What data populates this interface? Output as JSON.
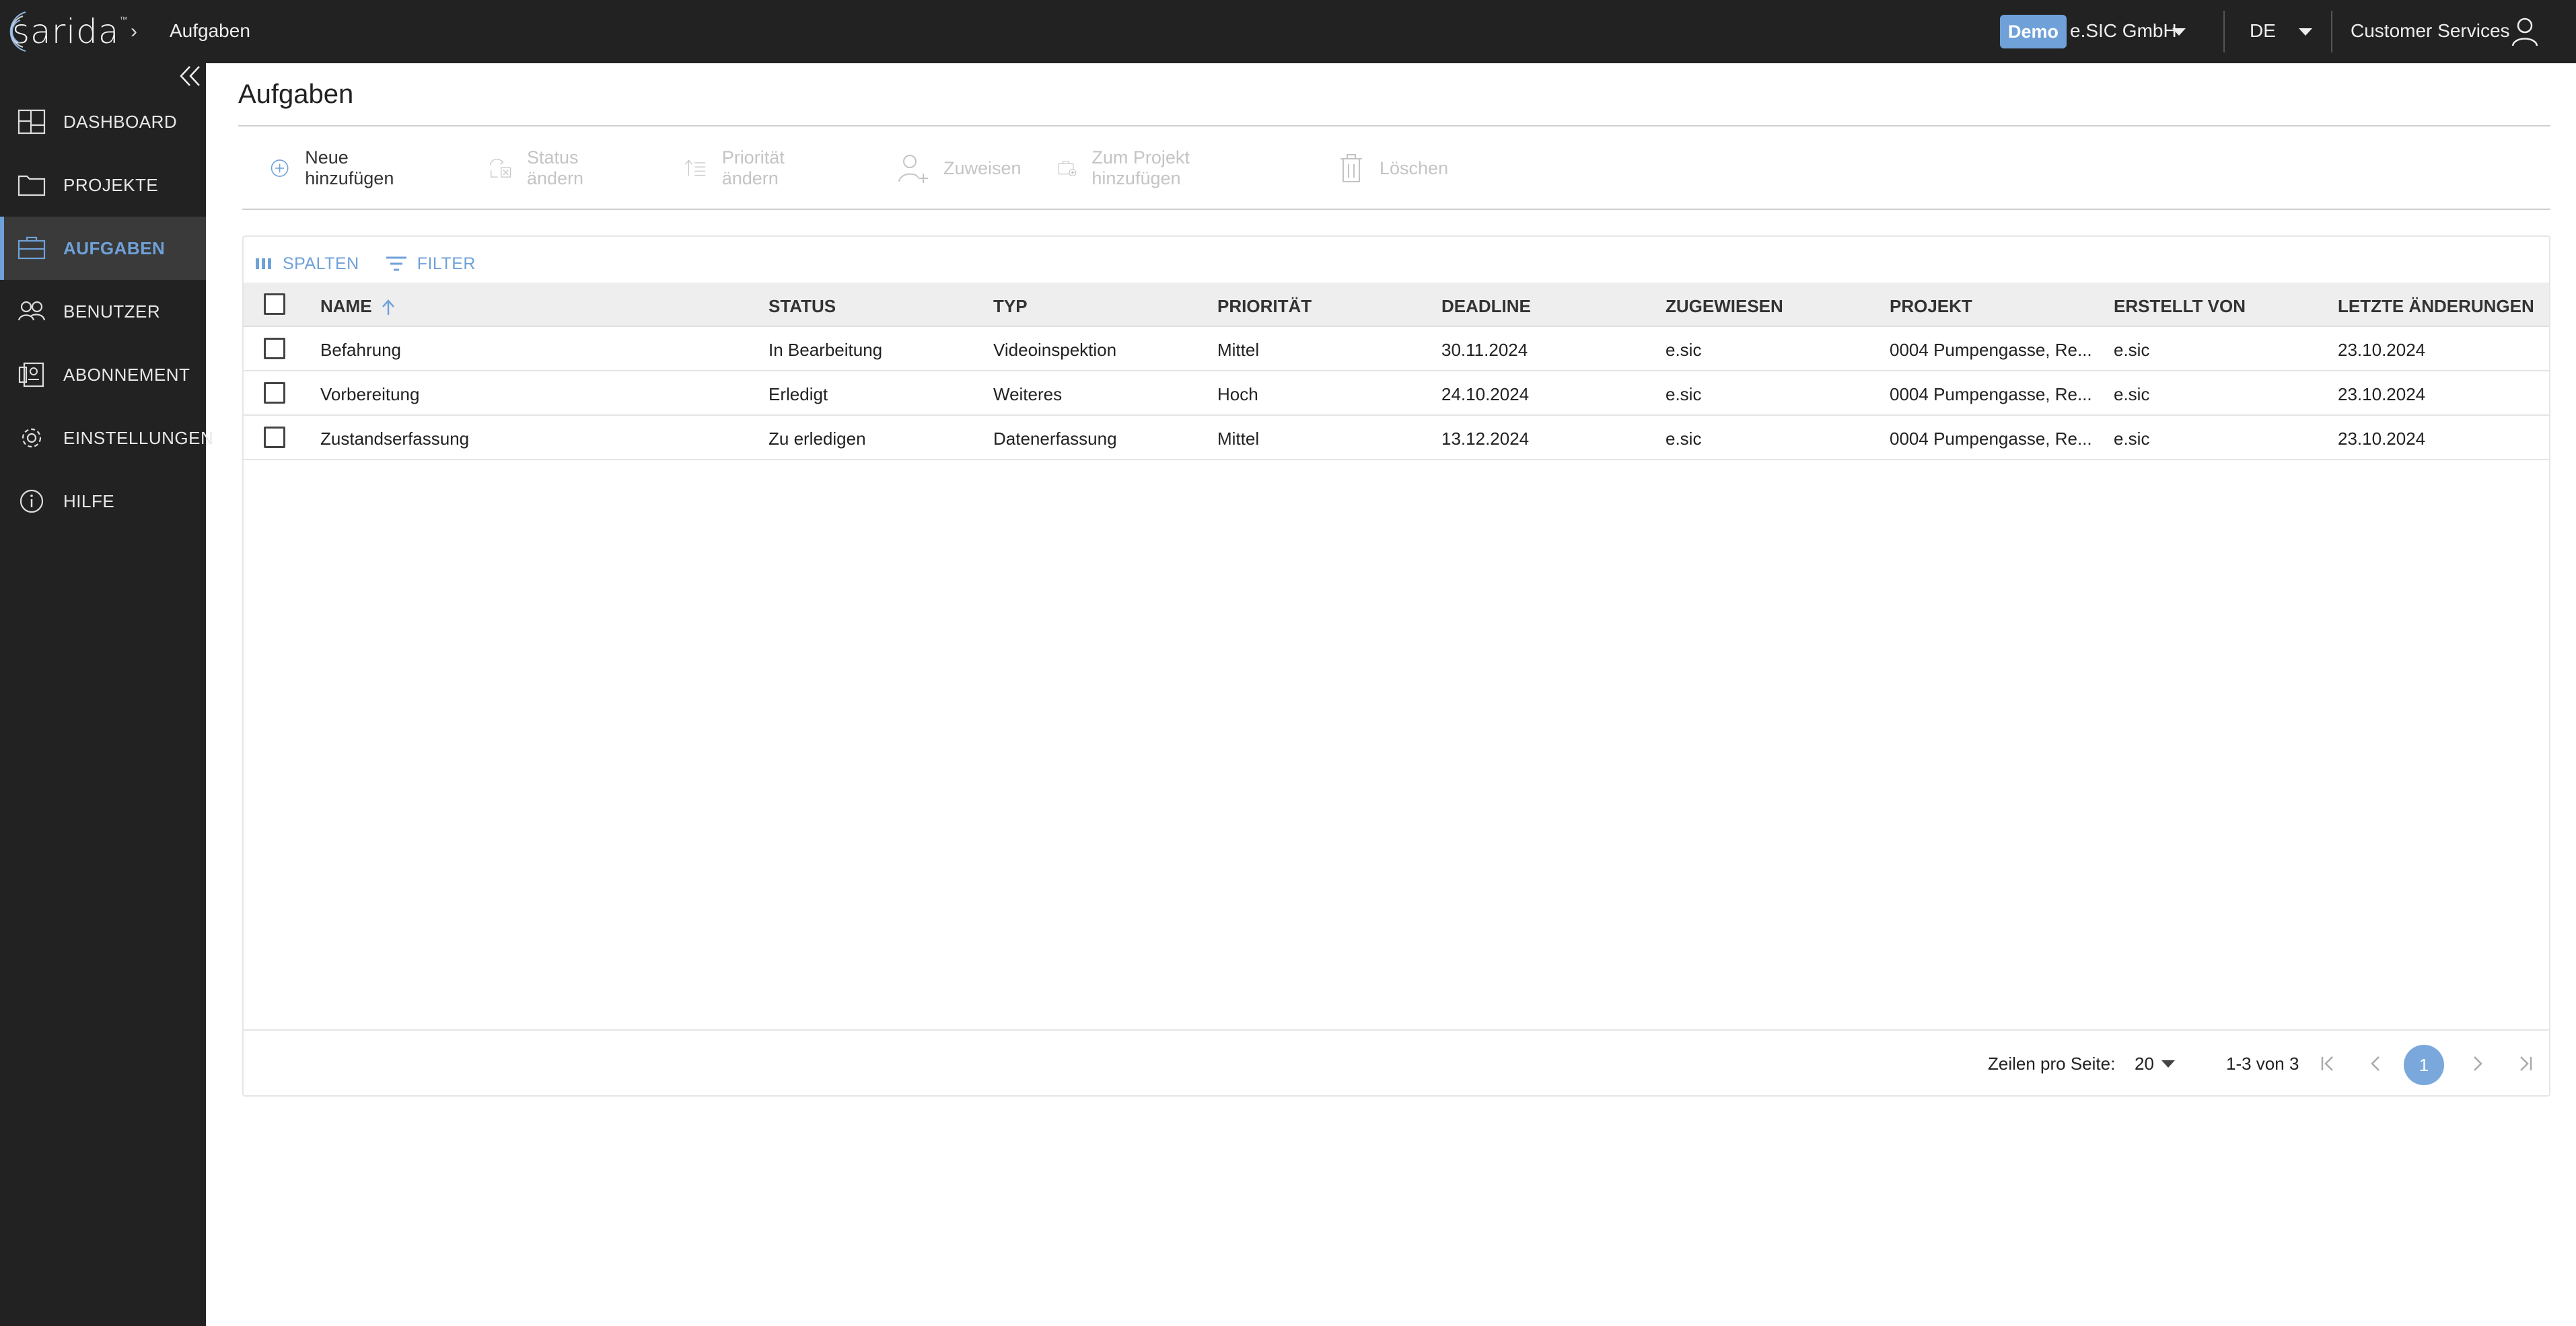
{
  "app": {
    "logo_text": "sarida",
    "logo_tm": "™",
    "breadcrumb_current": "Aufgaben"
  },
  "topbar": {
    "demo_badge": "Demo",
    "company": "e.SIC GmbH",
    "language": "DE",
    "user": "Customer Services"
  },
  "sidebar": {
    "items": [
      {
        "label": "DASHBOARD",
        "icon": "dashboard-icon"
      },
      {
        "label": "PROJEKTE",
        "icon": "folder-icon"
      },
      {
        "label": "AUFGABEN",
        "icon": "tasks-icon",
        "active": true
      },
      {
        "label": "BENUTZER",
        "icon": "users-icon"
      },
      {
        "label": "ABONNEMENT",
        "icon": "subscription-icon"
      },
      {
        "label": "EINSTELLUNGEN",
        "icon": "gear-icon"
      },
      {
        "label": "HILFE",
        "icon": "info-icon"
      }
    ]
  },
  "main": {
    "title": "Aufgaben",
    "toolbar": {
      "add": "Neue hinzufügen",
      "status": "Status ändern",
      "priority": "Priorität ändern",
      "assign": "Zuweisen",
      "to_project": "Zum Projekt hinzufügen",
      "delete": "Löschen"
    },
    "grid": {
      "columns_button": "SPALTEN",
      "filter_button": "FILTER",
      "headers": [
        "NAME",
        "STATUS",
        "TYP",
        "PRIORITÄT",
        "DEADLINE",
        "ZUGEWIESEN",
        "PROJEKT",
        "ERSTELLT VON",
        "LETZTE ÄNDERUNGEN"
      ],
      "sort_column": "NAME",
      "sort_direction": "ascending",
      "rows": [
        [
          "Befahrung",
          "In Bearbeitung",
          "Videoinspektion",
          "Mittel",
          "30.11.2024",
          "e.sic",
          "0004 Pumpengasse, Re...",
          "e.sic",
          "23.10.2024"
        ],
        [
          "Vorbereitung",
          "Erledigt",
          "Weiteres",
          "Hoch",
          "24.10.2024",
          "e.sic",
          "0004 Pumpengasse, Re...",
          "e.sic",
          "23.10.2024"
        ],
        [
          "Zustandserfassung",
          "Zu erledigen",
          "Datenerfassung",
          "Mittel",
          "13.12.2024",
          "e.sic",
          "0004 Pumpengasse, Re...",
          "e.sic",
          "23.10.2024"
        ]
      ],
      "footer": {
        "rows_per_page_label": "Zeilen pro Seite:",
        "rows_per_page": "20",
        "range": "1-3 von 3",
        "current_page": "1"
      }
    }
  },
  "colors": {
    "topbar_bg": "#222222",
    "accent": "#6fa1d8",
    "active_nav_bg": "#3a3a3a"
  }
}
